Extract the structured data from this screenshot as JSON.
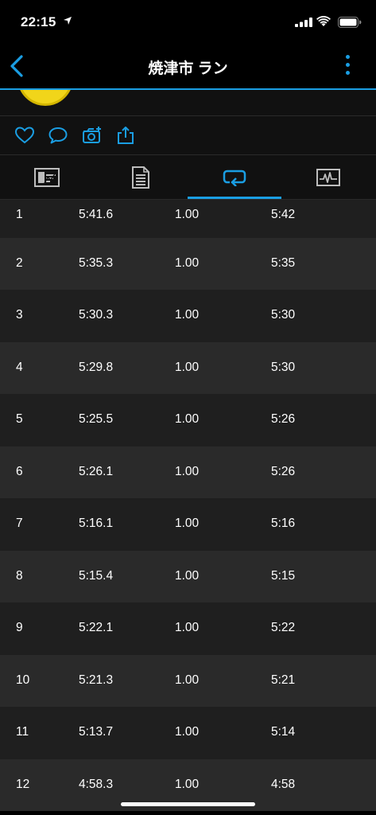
{
  "status": {
    "time": "22:15"
  },
  "nav": {
    "title": "焼津市 ラン"
  },
  "colors": {
    "accent": "#1a9ee3",
    "row_dark": "#1f1f1f",
    "row_light": "#2a2a2a"
  },
  "actions": [
    {
      "icon": "heart-icon"
    },
    {
      "icon": "comment-icon"
    },
    {
      "icon": "add-photo-icon"
    },
    {
      "icon": "share-icon"
    }
  ],
  "tabs": [
    {
      "icon": "summary-chart-icon",
      "active": false
    },
    {
      "icon": "details-list-icon",
      "active": false
    },
    {
      "icon": "laps-icon",
      "active": true
    },
    {
      "icon": "graphs-icon",
      "active": false
    }
  ],
  "laps": [
    {
      "lap": "1",
      "time": "5:41.6",
      "distance": "1.00",
      "pace": "5:42"
    },
    {
      "lap": "2",
      "time": "5:35.3",
      "distance": "1.00",
      "pace": "5:35"
    },
    {
      "lap": "3",
      "time": "5:30.3",
      "distance": "1.00",
      "pace": "5:30"
    },
    {
      "lap": "4",
      "time": "5:29.8",
      "distance": "1.00",
      "pace": "5:30"
    },
    {
      "lap": "5",
      "time": "5:25.5",
      "distance": "1.00",
      "pace": "5:26"
    },
    {
      "lap": "6",
      "time": "5:26.1",
      "distance": "1.00",
      "pace": "5:26"
    },
    {
      "lap": "7",
      "time": "5:16.1",
      "distance": "1.00",
      "pace": "5:16"
    },
    {
      "lap": "8",
      "time": "5:15.4",
      "distance": "1.00",
      "pace": "5:15"
    },
    {
      "lap": "9",
      "time": "5:22.1",
      "distance": "1.00",
      "pace": "5:22"
    },
    {
      "lap": "10",
      "time": "5:21.3",
      "distance": "1.00",
      "pace": "5:21"
    },
    {
      "lap": "11",
      "time": "5:13.7",
      "distance": "1.00",
      "pace": "5:14"
    },
    {
      "lap": "12",
      "time": "4:58.3",
      "distance": "1.00",
      "pace": "4:58"
    }
  ]
}
